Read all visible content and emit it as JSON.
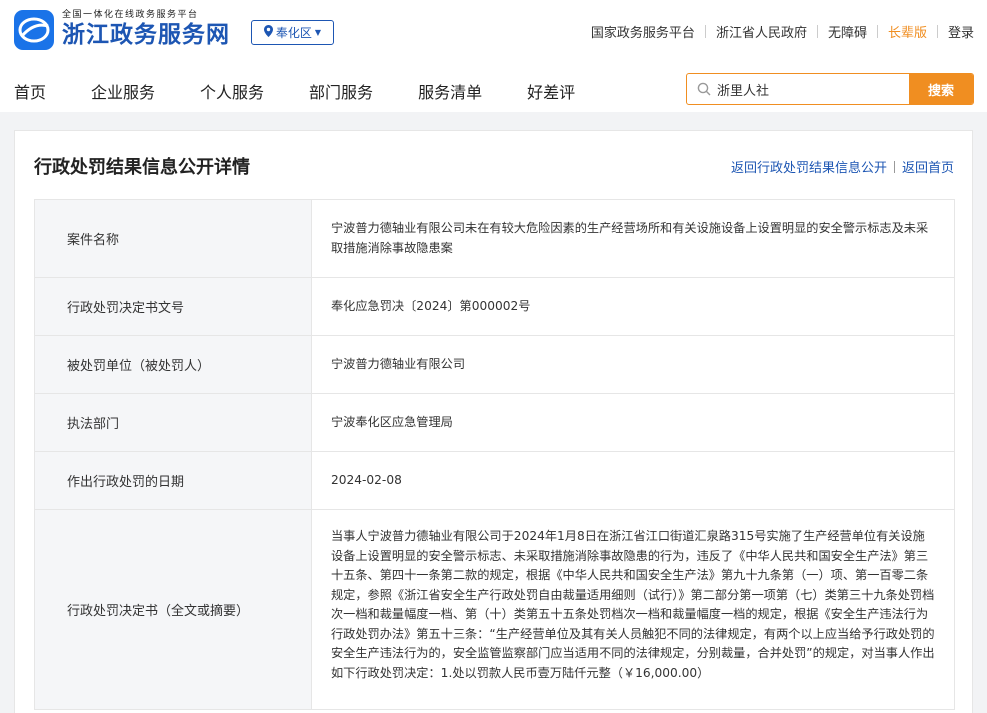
{
  "header": {
    "logo_subtitle": "全国一体化在线政务服务平台",
    "logo_title": "浙江政务服务网",
    "region": "奉化区",
    "top_links": [
      "国家政务服务平台",
      "浙江省人民政府",
      "无障碍",
      "长辈版",
      "登录"
    ]
  },
  "nav": {
    "items": [
      "首页",
      "企业服务",
      "个人服务",
      "部门服务",
      "服务清单",
      "好差评"
    ],
    "search_value": "浙里人社",
    "search_button": "搜索"
  },
  "page": {
    "title": "行政处罚结果信息公开详情",
    "link_back_list": "返回行政处罚结果信息公开",
    "link_back_home": "返回首页"
  },
  "details": [
    {
      "label": "案件名称",
      "value": "宁波普力德轴业有限公司未在有较大危险因素的生产经营场所和有关设施设备上设置明显的安全警示标志及未采取措施消除事故隐患案"
    },
    {
      "label": "行政处罚决定书文号",
      "value": "奉化应急罚决〔2024〕第000002号"
    },
    {
      "label": "被处罚单位（被处罚人）",
      "value": "宁波普力德轴业有限公司"
    },
    {
      "label": "执法部门",
      "value": "宁波奉化区应急管理局"
    },
    {
      "label": "作出行政处罚的日期",
      "value": "2024-02-08"
    },
    {
      "label": "行政处罚决定书（全文或摘要）",
      "value": "当事人宁波普力德轴业有限公司于2024年1月8日在浙江省江口街道汇泉路315号实施了生产经营单位有关设施设备上设置明显的安全警示标志、未采取措施消除事故隐患的行为，违反了《中华人民共和国安全生产法》第三十五条、第四十一条第二款的规定，根据《中华人民共和国安全生产法》第九十九条第（一）项、第一百零二条规定，参照《浙江省安全生产行政处罚自由裁量适用细则（试行）》第二部分第一项第（七）类第三十九条处罚档次一档和裁量幅度一档、第（十）类第五十五条处罚档次一档和裁量幅度一档的规定，根据《安全生产违法行为行政处罚办法》第五十三条：“生产经营单位及其有关人员触犯不同的法律规定，有两个以上应当给予行政处罚的安全生产违法行为的，安全监管监察部门应当适用不同的法律规定，分别裁量，合并处罚”的规定，对当事人作出如下行政处罚决定：1.处以罚款人民币壹万陆仟元整（￥16,000.00）"
    }
  ],
  "colors": {
    "brand_blue": "#1d56b3",
    "accent_orange": "#f08e21"
  }
}
